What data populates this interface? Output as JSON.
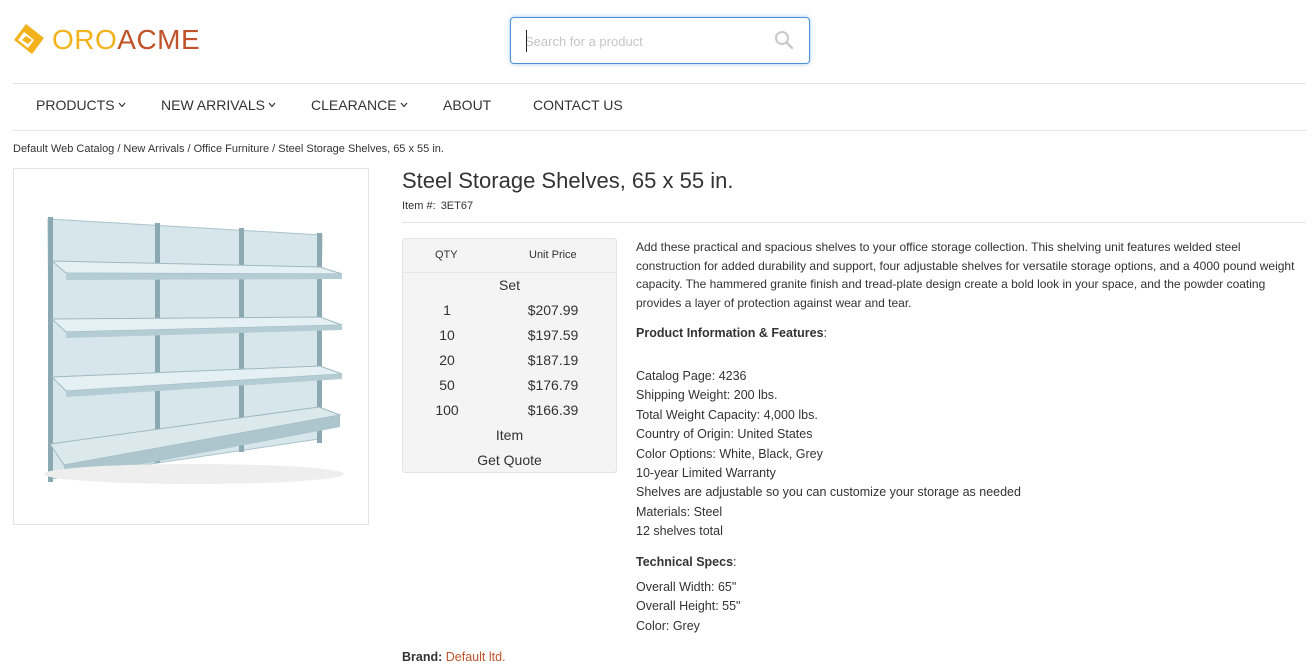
{
  "header": {
    "logo": {
      "part1": "ORO",
      "part2": "ACME"
    },
    "search": {
      "placeholder": "Search for a product",
      "value": ""
    }
  },
  "nav": {
    "items": [
      {
        "label": "PRODUCTS",
        "dropdown": true
      },
      {
        "label": "NEW ARRIVALS",
        "dropdown": true
      },
      {
        "label": "CLEARANCE",
        "dropdown": true
      },
      {
        "label": "ABOUT",
        "dropdown": false
      },
      {
        "label": "CONTACT US",
        "dropdown": false
      }
    ]
  },
  "breadcrumb": [
    "Default Web Catalog",
    "New Arrivals",
    "Office Furniture",
    "Steel Storage Shelves, 65 x 55 in."
  ],
  "product": {
    "title": "Steel Storage Shelves, 65 x 55 in.",
    "item_label": "Item #:",
    "item_number": "3ET67",
    "pricing": {
      "qty_header": "QTY",
      "price_header": "Unit Price",
      "unit_set": "Set",
      "rows": [
        {
          "qty": "1",
          "price": "$207.99"
        },
        {
          "qty": "10",
          "price": "$197.59"
        },
        {
          "qty": "20",
          "price": "$187.19"
        },
        {
          "qty": "50",
          "price": "$176.79"
        },
        {
          "qty": "100",
          "price": "$166.39"
        }
      ],
      "unit_item": "Item",
      "get_quote": "Get Quote"
    },
    "description": "Add these practical and spacious shelves to your office storage collection. This shelving unit features welded steel construction for added durability and support, four adjustable shelves for versatile storage options, and a 4000 pound weight capacity. The hammered granite finish and tread-plate design create a bold look in your space, and the powder coating provides a layer of protection against wear and tear.",
    "features_heading": "Product Information & Features",
    "features": [
      "Catalog Page: 4236",
      "Shipping Weight: 200 lbs.",
      "Total Weight Capacity: 4,000 lbs.",
      "Country of Origin: United States",
      "Color Options: White, Black, Grey",
      "10-year Limited Warranty",
      "Shelves are adjustable so you can customize your storage as needed",
      "Materials: Steel",
      "12 shelves total"
    ],
    "specs_heading": "Technical Specs",
    "specs": [
      "Overall Width: 65\"",
      "Overall Height: 55\"",
      "Color: Grey"
    ],
    "brand_label": "Brand:",
    "brand_value": "Default ltd."
  },
  "colors": {
    "logo_yellow": "#f2b21c",
    "logo_orange": "#c0532a",
    "search_focus": "#4a90d9",
    "shelf": "#c9dde3"
  }
}
